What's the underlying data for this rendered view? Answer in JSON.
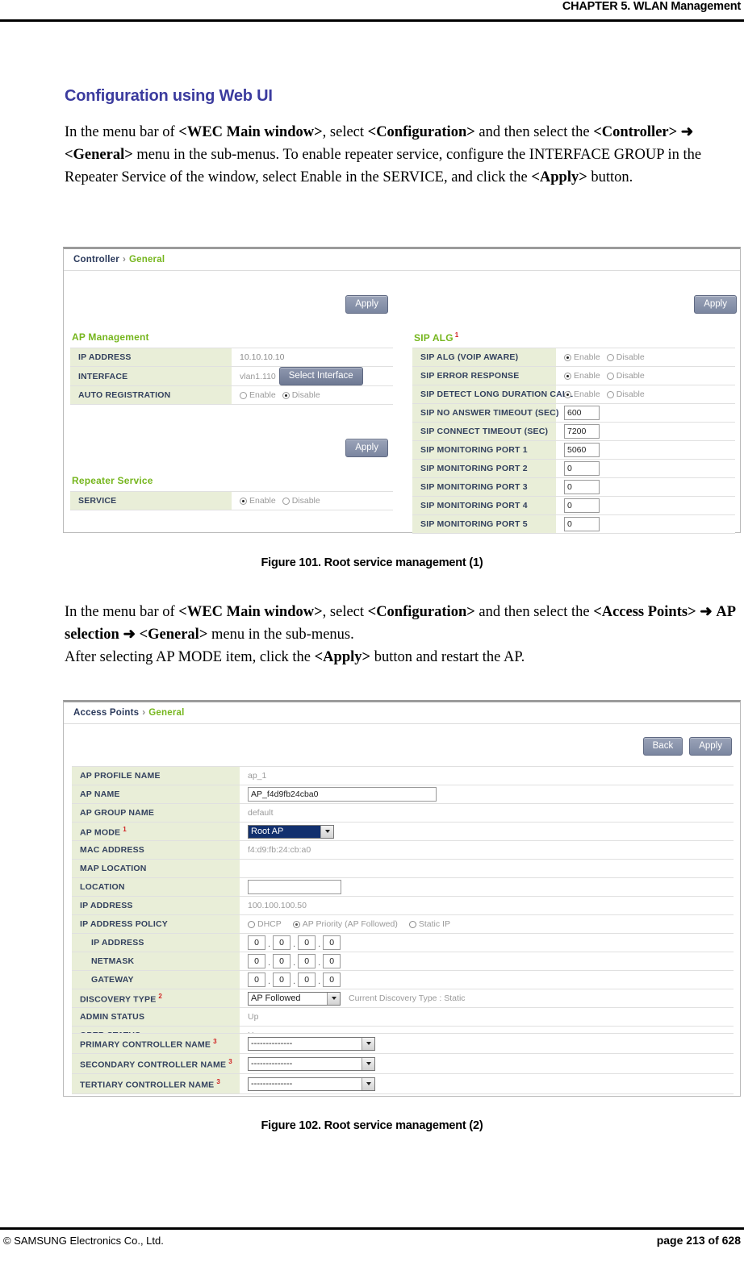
{
  "page": {
    "chapter_header": "CHAPTER 5. WLAN Management",
    "footer_left": "© SAMSUNG Electronics Co., Ltd.",
    "footer_right": "page 213 of 628"
  },
  "section": {
    "title": "Configuration using Web UI",
    "paragraph1_html": "In the menu bar of <b>&lt;WEC Main window&gt;</b>, select <b>&lt;Configuration&gt;</b> and then select the <b>&lt;Controller&gt;</b> <b>&#10140;</b> <b>&lt;General&gt;</b> menu in the sub-menus. To enable repeater service, configure the INTERFACE GROUP in the Repeater Service of the window, select Enable in the SERVICE, and click the <b>&lt;Apply&gt;</b> button.",
    "paragraph2_html": "In the menu bar of <b>&lt;WEC Main window&gt;</b>, select <b>&lt;Configuration&gt;</b> and then select the <b>&lt;Access Points&gt;</b> <b>&#10140;</b> <b>AP selection</b> <b>&#10140;</b> <b>&lt;General&gt;</b> menu in the sub-menus.<br>After selecting AP MODE item, click the <b>&lt;Apply&gt;</b> button and restart the AP.",
    "caption1": "Figure 101. Root service management (1)",
    "caption2": "Figure 102. Root service management (2)"
  },
  "colors": {
    "heading_blue": "#3b3b9e",
    "breadcrumb_green": "#76b61e",
    "label_bg_green": "#e9eed8",
    "superscript_red": "#d02020",
    "select_highlight_navy": "#12306e"
  },
  "figure1": {
    "breadcrumb": {
      "root": "Controller",
      "separator": "›",
      "leaf": "General"
    },
    "apply_left_label": "Apply",
    "apply_right_label": "Apply",
    "apply_left2_label": "Apply",
    "left": {
      "group1_title": "AP Management",
      "rows": [
        {
          "label": "IP ADDRESS",
          "type": "readonly",
          "value": "10.10.10.10"
        },
        {
          "label": "INTERFACE",
          "type": "interface",
          "value": "vlan1.110",
          "button": "Select Interface"
        },
        {
          "label": "AUTO REGISTRATION",
          "type": "radio",
          "options": [
            "Enable",
            "Disable"
          ],
          "selected": "Disable"
        }
      ],
      "group2_title": "Repeater Service",
      "rows2": [
        {
          "label": "SERVICE",
          "type": "radio",
          "options": [
            "Enable",
            "Disable"
          ],
          "selected": "Enable"
        }
      ]
    },
    "right": {
      "group_title": "SIP ALG",
      "group_sup": "1",
      "rows": [
        {
          "label": "SIP ALG (VOIP AWARE)",
          "type": "radio",
          "options": [
            "Enable",
            "Disable"
          ],
          "selected": "Enable"
        },
        {
          "label": "SIP ERROR RESPONSE",
          "type": "radio",
          "options": [
            "Enable",
            "Disable"
          ],
          "selected": "Enable"
        },
        {
          "label": "SIP DETECT LONG DURATION CALL",
          "type": "radio",
          "options": [
            "Enable",
            "Disable"
          ],
          "selected": "Enable"
        },
        {
          "label": "SIP NO ANSWER TIMEOUT (SEC)",
          "type": "input",
          "value": "600"
        },
        {
          "label": "SIP CONNECT TIMEOUT (SEC)",
          "type": "input",
          "value": "7200"
        },
        {
          "label": "SIP MONITORING PORT 1",
          "type": "input",
          "value": "5060"
        },
        {
          "label": "SIP MONITORING PORT 2",
          "type": "input",
          "value": "0"
        },
        {
          "label": "SIP MONITORING PORT 3",
          "type": "input",
          "value": "0"
        },
        {
          "label": "SIP MONITORING PORT 4",
          "type": "input",
          "value": "0"
        },
        {
          "label": "SIP MONITORING PORT 5",
          "type": "input",
          "value": "0"
        }
      ]
    }
  },
  "figure2": {
    "breadcrumb": {
      "root": "Access Points",
      "separator": "›",
      "leaf": "General"
    },
    "back_label": "Back",
    "apply_label": "Apply",
    "rows": [
      {
        "label": "AP PROFILE NAME",
        "type": "readonly",
        "value": "ap_1"
      },
      {
        "label": "AP NAME",
        "type": "input",
        "value": "AP_f4d9fb24cba0"
      },
      {
        "label": "AP GROUP NAME",
        "type": "readonly",
        "value": "default"
      },
      {
        "label": "AP MODE",
        "sup": "1",
        "type": "select",
        "value": "Root AP"
      },
      {
        "label": "MAC ADDRESS",
        "type": "readonly",
        "value": "f4:d9:fb:24:cb:a0"
      },
      {
        "label": "MAP LOCATION",
        "type": "readonly",
        "value": ""
      },
      {
        "label": "LOCATION",
        "type": "input",
        "value": ""
      },
      {
        "label": "IP ADDRESS",
        "type": "readonly",
        "value": "100.100.100.50"
      },
      {
        "label": "IP ADDRESS POLICY",
        "type": "radio3",
        "options": [
          "DHCP",
          "AP Priority (AP Followed)",
          "Static IP"
        ],
        "selected": "AP Priority (AP Followed)"
      },
      {
        "label": "IP ADDRESS",
        "indent": true,
        "type": "octets",
        "octets": [
          "0",
          "0",
          "0",
          "0"
        ]
      },
      {
        "label": "NETMASK",
        "indent": true,
        "type": "octets",
        "octets": [
          "0",
          "0",
          "0",
          "0"
        ]
      },
      {
        "label": "GATEWAY",
        "indent": true,
        "type": "octets",
        "octets": [
          "0",
          "0",
          "0",
          "0"
        ]
      },
      {
        "label": "DISCOVERY TYPE",
        "sup": "2",
        "type": "select_note",
        "value": "AP Followed",
        "note": "Current Discovery Type : Static"
      },
      {
        "label": "ADMIN STATUS",
        "type": "readonly",
        "value": "Up"
      },
      {
        "label": "OPER STATUS",
        "type": "readonly",
        "value": "Up"
      }
    ],
    "rows2": [
      {
        "label": "PRIMARY CONTROLLER NAME",
        "sup": "3",
        "type": "select_wide",
        "value": "--------------"
      },
      {
        "label": "SECONDARY CONTROLLER NAME",
        "sup": "3",
        "type": "select_wide",
        "value": "--------------"
      },
      {
        "label": "TERTIARY CONTROLLER NAME",
        "sup": "3",
        "type": "select_wide",
        "value": "--------------"
      }
    ]
  }
}
